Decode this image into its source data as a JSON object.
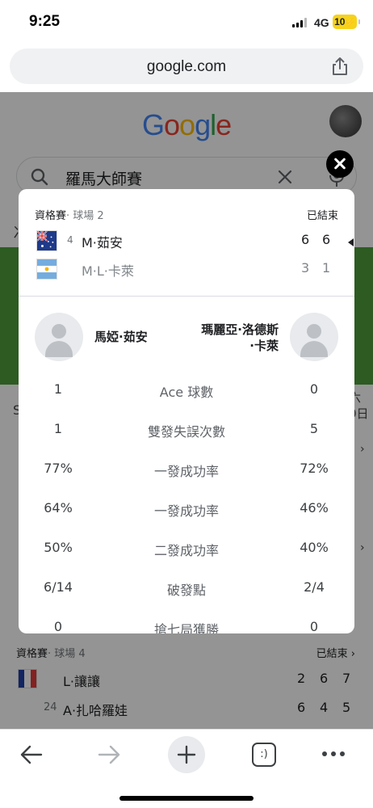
{
  "status_bar": {
    "time": "9:25",
    "network": "4G",
    "battery": "10"
  },
  "url_bar": {
    "url": "google.com"
  },
  "background": {
    "logo": "Google",
    "search_query": "羅馬大師賽",
    "partial_date": "六\n0日",
    "lower_match": {
      "header": "資格賽",
      "subheader": "· 球場 4",
      "status": "已結束",
      "players": [
        {
          "seed": "",
          "name": "L·讓讓",
          "scores": [
            "2",
            "6",
            "7"
          ]
        },
        {
          "seed": "24",
          "name": "A·扎哈羅娃",
          "scores": [
            "6",
            "4",
            "5"
          ]
        }
      ]
    }
  },
  "modal": {
    "header": "資格賽",
    "subheader": "· 球場 2",
    "status": "已結束",
    "players": [
      {
        "seed": "4",
        "name": "M·茹安",
        "scores": [
          "6",
          "6"
        ],
        "winner": true
      },
      {
        "seed": "",
        "name": "M·L·卡萊",
        "scores": [
          "3",
          "1"
        ],
        "winner": false
      }
    ],
    "left_player_full": "馬婭·茹安",
    "right_player_full_line1": "瑪麗亞·洛德斯",
    "right_player_full_line2": "·卡萊",
    "stats": [
      {
        "left": "1",
        "label": "Ace 球數",
        "right": "0"
      },
      {
        "left": "1",
        "label": "雙發失誤次數",
        "right": "5"
      },
      {
        "left": "77%",
        "label": "一發成功率",
        "right": "72%"
      },
      {
        "left": "64%",
        "label": "一發成功率",
        "right": "46%"
      },
      {
        "left": "50%",
        "label": "二發成功率",
        "right": "40%"
      },
      {
        "left": "6/14",
        "label": "破發點",
        "right": "2/4"
      },
      {
        "left": "0",
        "label": "搶七局獲勝",
        "right": "0"
      }
    ]
  },
  "toolbar": {
    "tabs_label": ":)"
  },
  "colors": {
    "green_band": "#4e9e3c",
    "battery": "#f6d21a"
  }
}
